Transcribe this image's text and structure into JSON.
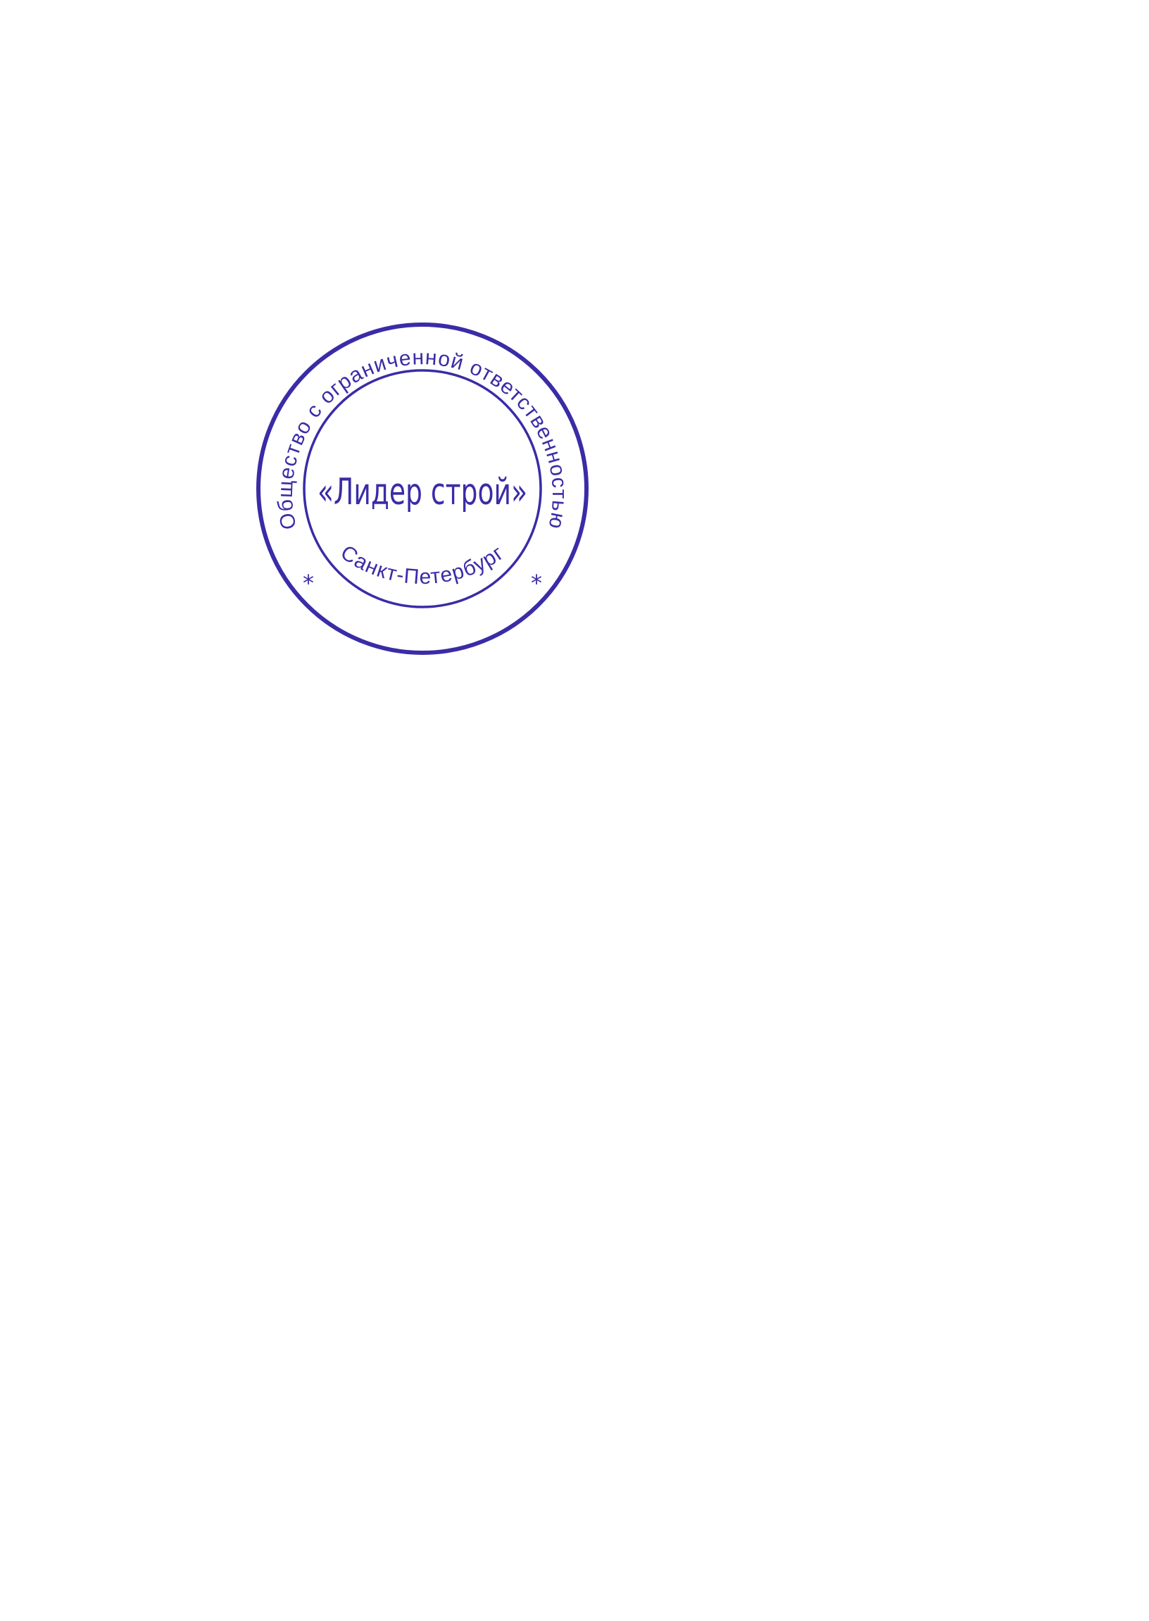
{
  "document": {
    "stamp": {
      "top_text": "Общество с ограниченной ответственностью",
      "bottom_text": "Санкт-Петербург",
      "center_text": "«Лидер строй»",
      "star_symbol": "*",
      "ink_color": "#3a2ca6",
      "type": "round company seal"
    }
  }
}
